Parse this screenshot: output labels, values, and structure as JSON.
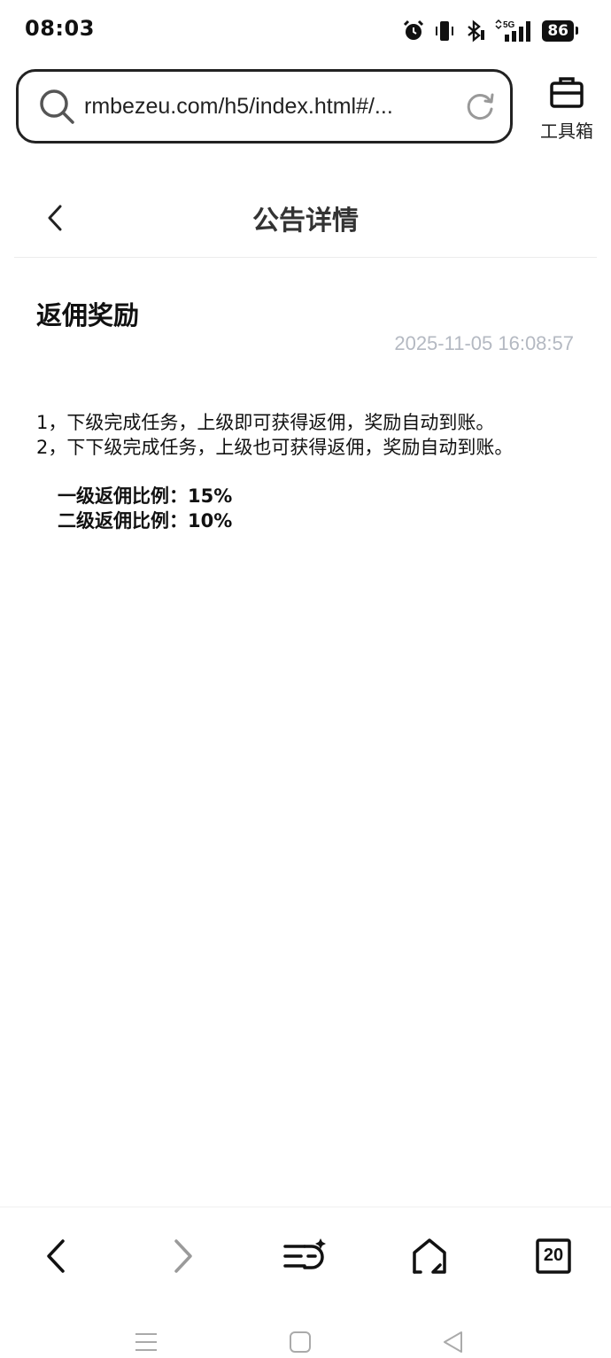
{
  "status_bar": {
    "time": "08:03",
    "battery": "86",
    "network": "5G",
    "icons": [
      "alarm-icon",
      "vibrate-icon",
      "bluetooth-icon",
      "signal-icon",
      "battery-icon"
    ]
  },
  "browser": {
    "url": "rmbezeu.com/h5/index.html#/...",
    "toolbox_label": "工具箱",
    "tab_count": "20"
  },
  "header": {
    "title": "公告详情"
  },
  "notice": {
    "title": "返佣奖励",
    "date": "2025-11-05 16:08:57",
    "lines": [
      "1，下级完成任务，上级即可获得返佣，奖励自动到账。",
      "2，下下级完成任务，上级也可获得返佣，奖励自动到账。"
    ],
    "ratios": [
      "一级返佣比例：15%",
      "二级返佣比例：10%"
    ]
  },
  "colors": {
    "text": "#111111",
    "date": "#b4b9c2",
    "title": "#333333",
    "forward_disabled": "#9a9a9a",
    "system_nav": "#aaaaaa"
  }
}
